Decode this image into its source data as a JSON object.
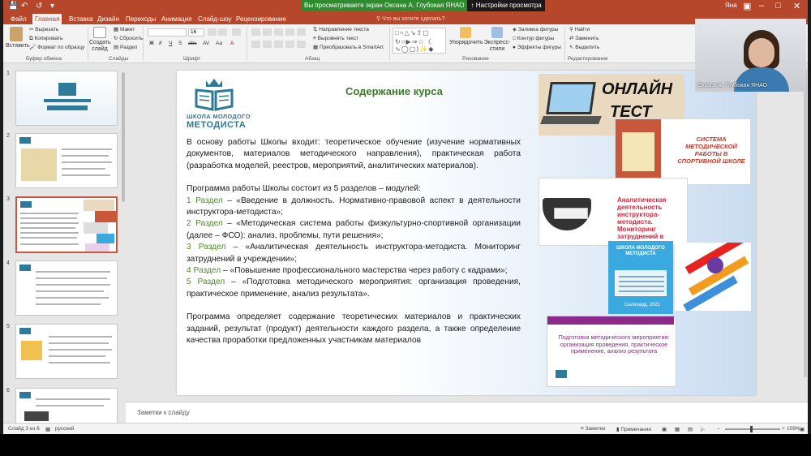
{
  "app": {
    "user_name": "Оксана А. Глубокая ЯНАО",
    "window_user_short": "Яна"
  },
  "share_banner": {
    "message": "Вы просматриваете экран Оксана А. Глубокая ЯНАО",
    "settings": "Настройки просмотра"
  },
  "tabs": [
    {
      "label": "Файл"
    },
    {
      "label": "Главная"
    },
    {
      "label": "Вставка"
    },
    {
      "label": "Дизайн"
    },
    {
      "label": "Переходы"
    },
    {
      "label": "Анимация"
    },
    {
      "label": "Слайд-шоу"
    },
    {
      "label": "Рецензирование"
    }
  ],
  "tell_me": "Что вы хотите сделать?",
  "ribbon": {
    "clipboard": {
      "paste": "Вставить",
      "cut": "Вырезать",
      "copy": "Копировать",
      "format_painter": "Формат по образцу",
      "label": "Буфер обмена"
    },
    "slides": {
      "new_slide": "Создать слайд",
      "layout": "Макет",
      "reset": "Сбросить",
      "section": "Раздел",
      "label": "Слайды"
    },
    "font": {
      "size": "16",
      "label": "Шрифт"
    },
    "paragraph": {
      "text_direction": "Направление текста",
      "align_text": "Выровнять текст",
      "smartart": "Преобразовать в SmartArt",
      "label": "Абзац"
    },
    "drawing": {
      "arrange": "Упорядочить",
      "quick_styles": "Экспресс-стили",
      "shape_fill": "Заливка фигуры",
      "shape_outline": "Контур фигуры",
      "shape_effects": "Эффекты фигуры",
      "label": "Рисование"
    },
    "editing": {
      "find": "Найти",
      "replace": "Заменить",
      "select": "Выделить",
      "label": "Редактирование"
    }
  },
  "thumbnails": [
    {
      "number": "1"
    },
    {
      "number": "2"
    },
    {
      "number": "3"
    },
    {
      "number": "4"
    },
    {
      "number": "5"
    },
    {
      "number": "6"
    }
  ],
  "slide": {
    "logo_line1": "ШКОЛА МОЛОДОГО",
    "logo_line2": "МЕТОДИСТА",
    "title": "Содержание курса",
    "paragraph1": "В основу работы Школы входит: теоретическое обучение (изучение нормативных документов, материалов методического направления), практическая работа (разработка моделей, реестров, мероприятий, аналитических материалов).",
    "program_intro": "Программа работы Школы состоит из 5 разделов – модулей:",
    "modules": [
      {
        "label": "1 Раздел",
        "text": " – «Введение в должность. Нормативно-правовой аспект в деятельности инструктора-методиста»;"
      },
      {
        "label": "2 Раздел",
        "text": " – «Методическая система работы физкультурно-спортивной организации (далее – ФСО): анализ, проблемы, пути решения»;"
      },
      {
        "label": "3 Раздел",
        "text": " – «Аналитическая деятельность инструктора-методиста. Мониторинг затруднений в учреждении»;"
      },
      {
        "label": "4 Раздел",
        "text": " – «Повышение профессионального мастерства через работу с кадрами»;"
      },
      {
        "label": "5 Раздел",
        "text": " – «Подготовка методического мероприятия: организация проведения, практическое применение, анализ результата»."
      }
    ],
    "paragraph3": "Программа определяет содержание теоретических материалов и практических заданий, результат (продукт) деятельности каждого раздела, а также определение качества проработки предложенных участникам материалов",
    "images": {
      "online_word1": "ОНЛАЙН",
      "online_word2": "ТЕСТ",
      "sistema_title": "СИСТЕМА МЕТОДИЧЕСКОЙ РАБОТЫ В СПОРТИВНОЙ ШКОЛЕ",
      "analytic_title": "Аналитическая деятельность инструктора-методиста. Мониторинг затруднений в учреждении",
      "school_title": "ШКОЛА МОЛОДОГО МЕТОДИСТА",
      "school_year": "Салехард, 2021",
      "podgotovka_title": "Подготовка методического мероприятия: организация проведения, практическое применение, анализ результата"
    }
  },
  "notes_placeholder": "Заметки к слайду",
  "statusbar": {
    "slide_info": "Слайд 3 из 6",
    "language": "русский",
    "notes": "Заметки",
    "comments": "Примечания",
    "zoom": "109%"
  },
  "colors": {
    "ppt_accent": "#b7472a",
    "title_green": "#3b7a2a",
    "logo_teal": "#2e7a96",
    "banner_green": "#2e8b2e"
  }
}
